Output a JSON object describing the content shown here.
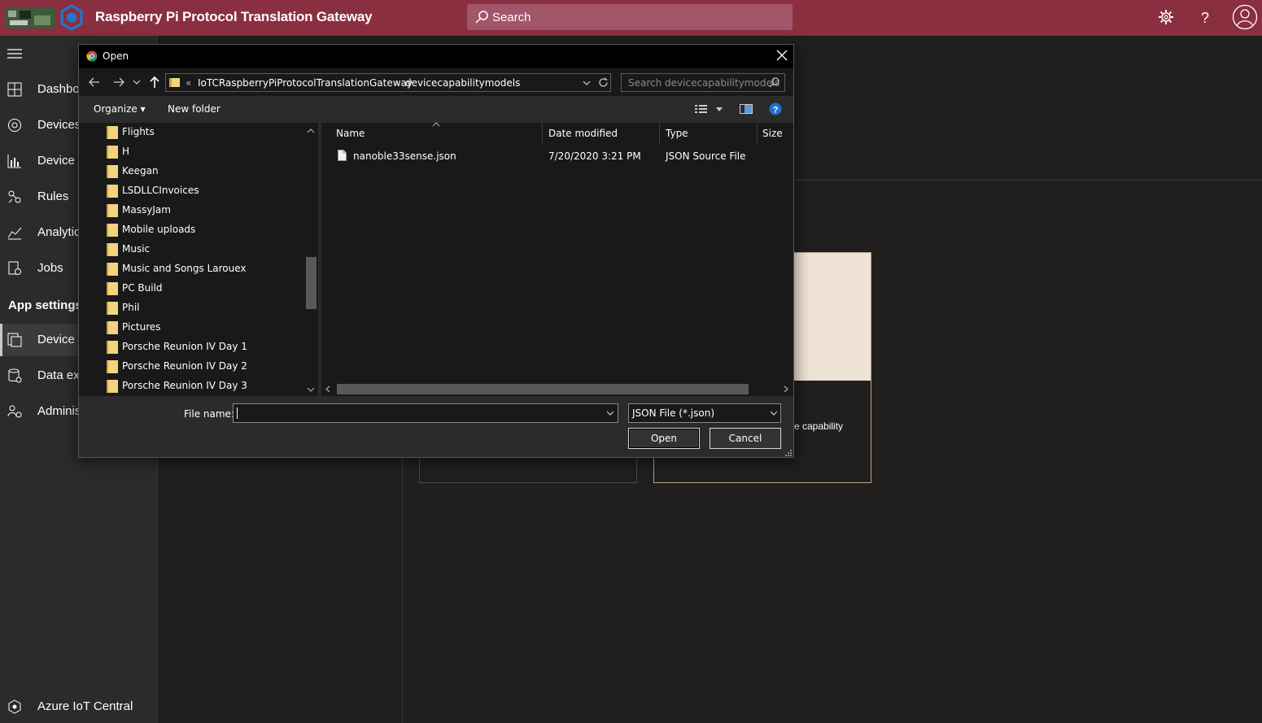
{
  "header": {
    "title": "Raspberry Pi Protocol Translation Gateway",
    "search_placeholder": "Search",
    "icons": [
      "gear-icon",
      "help-icon",
      "user-icon"
    ]
  },
  "sidebar": {
    "items": [
      {
        "label": "Dashboa",
        "icon": "dashboard-icon"
      },
      {
        "label": "Devices",
        "icon": "devices-icon"
      },
      {
        "label": "Device g",
        "icon": "device-groups-icon"
      },
      {
        "label": "Rules",
        "icon": "rules-icon"
      },
      {
        "label": "Analytic",
        "icon": "analytics-icon"
      },
      {
        "label": "Jobs",
        "icon": "jobs-icon"
      }
    ],
    "section_header": "App settings",
    "settings_items": [
      {
        "label": "Device t",
        "icon": "device-templates-icon",
        "active": true
      },
      {
        "label": "Data exp",
        "icon": "data-export-icon"
      },
      {
        "label": "Adminis",
        "icon": "administration-icon"
      }
    ],
    "footer": "Azure IoT Central"
  },
  "background": {
    "card_text": "e capability"
  },
  "dialog": {
    "title": "Open",
    "address": {
      "chevron": "«",
      "segment1": "IoTCRaspberryPiProtocolTranslationGateway",
      "separator": "›",
      "segment2": "devicecapabilitymodels"
    },
    "search_placeholder": "Search devicecapabilitymodels",
    "commands": {
      "organize": "Organize ▾",
      "new_folder": "New folder"
    },
    "tree": [
      "Flights",
      "H",
      "Keegan",
      "LSDLLCInvoices",
      "MassyJam",
      "Mobile uploads",
      "Music",
      "Music and Songs Larouex",
      "PC Build",
      "Phil",
      "Pictures",
      "Porsche Reunion IV Day 1",
      "Porsche Reunion IV Day 2",
      "Porsche Reunion IV Day 3"
    ],
    "columns": {
      "name": "Name",
      "date": "Date modified",
      "type": "Type",
      "size": "Size"
    },
    "files": [
      {
        "name": "nanoble33sense.json",
        "date": "7/20/2020 3:21 PM",
        "type": "JSON Source File",
        "size": ""
      }
    ],
    "file_name_label": "File name:",
    "file_name_value": "",
    "file_type": "JSON File (*.json)",
    "open_label": "Open",
    "cancel_label": "Cancel"
  },
  "colors": {
    "header_bg": "#8a2f40",
    "sidebar_bg": "#2b2b2b",
    "dialog_bg": "#191919",
    "folder_yellow": "#f3d37d"
  }
}
